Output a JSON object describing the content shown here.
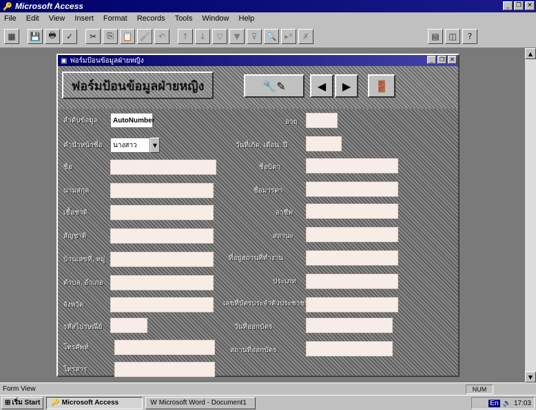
{
  "app": {
    "title": "Microsoft Access"
  },
  "menu": [
    "File",
    "Edit",
    "View",
    "Insert",
    "Format",
    "Records",
    "Tools",
    "Window",
    "Help"
  ],
  "child_window": {
    "title": "ฟอร์มป้อนข้อมูลฝ่ายหญิง"
  },
  "form": {
    "title": "ฟอร์มป้อนข้อมูลฝ่ายหญิง",
    "left_fields": [
      {
        "label": "ลำดับข้อมูล",
        "value": "AutoNumber"
      },
      {
        "label": "คำนำหน้าชื่อ",
        "value": "นางสาว"
      },
      {
        "label": "ชื่อ",
        "value": ""
      },
      {
        "label": "นามสกุล",
        "value": ""
      },
      {
        "label": "เชื้อชาติ",
        "value": ""
      },
      {
        "label": "สัญชาติ",
        "value": ""
      },
      {
        "label": "บ้านเลขที่, หมู่",
        "value": ""
      },
      {
        "label": "ตำบล, อำเภอ",
        "value": ""
      },
      {
        "label": "จังหวัด",
        "value": ""
      },
      {
        "label": "รหัสไปรษณีย์",
        "value": ""
      },
      {
        "label": "โทรศัพท์",
        "value": ""
      },
      {
        "label": "โทรสาร",
        "value": ""
      }
    ],
    "right_fields": [
      {
        "label": "อายุ",
        "value": ""
      },
      {
        "label": "วันที่เกิด, เดือน, ปี",
        "value": ""
      },
      {
        "label": "ชื่อบิดา",
        "value": ""
      },
      {
        "label": "ชื่อมารดา",
        "value": ""
      },
      {
        "label": "อาชีพ",
        "value": ""
      },
      {
        "label": "สถานะ",
        "value": ""
      },
      {
        "label": "ที่อยู่สถานที่ทำงาน",
        "value": ""
      },
      {
        "label": "ประเภท",
        "value": ""
      },
      {
        "label": "เลขที่บัตรประจำตัวประชาชน",
        "value": ""
      },
      {
        "label": "วันที่ออกบัตร",
        "value": ""
      },
      {
        "label": "สถานที่ออกบัตร",
        "value": ""
      }
    ]
  },
  "status": {
    "text": "Form View",
    "num": "NUM"
  },
  "taskbar": {
    "start": "เริ่ม Start",
    "items": [
      "Microsoft Access",
      "Microsoft Word - Document1"
    ],
    "lang": "En",
    "clock": "17:03"
  }
}
